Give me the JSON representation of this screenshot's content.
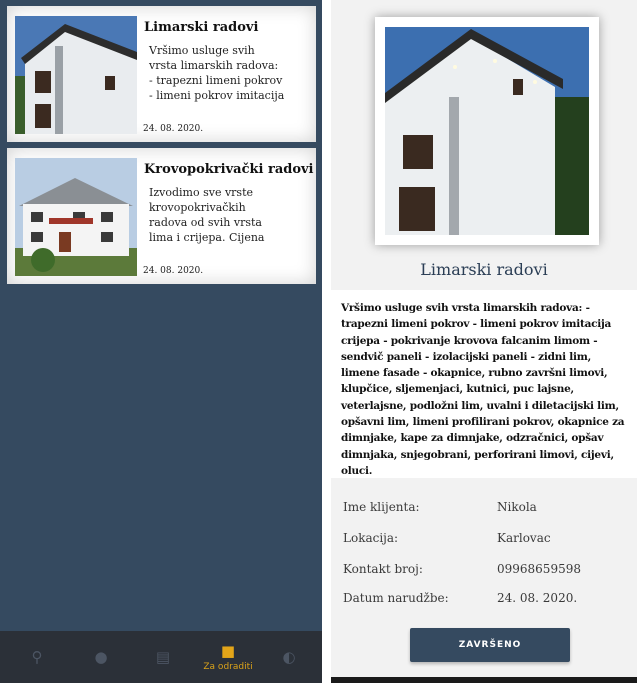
{
  "list": {
    "items": [
      {
        "title": "Limarski radovi",
        "lines": [
          "Vršimo usluge svih",
          "vrsta limarskih radova:",
          "- trapezni limeni pokrov",
          "- limeni pokrov imitacija"
        ],
        "date": "24. 08. 2020."
      },
      {
        "title": "Krovopokrivački radovi",
        "lines": [
          "Izvodimo sve vrste",
          "krovopokrivačkih",
          "radova od svih vrsta",
          "lima i crijepa.   Cijena"
        ],
        "date": "24. 08. 2020."
      }
    ]
  },
  "nav": {
    "active_label": "Za odraditi",
    "icons": [
      "search-icon",
      "person-icon",
      "list-icon",
      "briefcase-icon",
      "moon-icon"
    ],
    "accent": "#e3a519"
  },
  "detail": {
    "title": "Limarski radovi",
    "description": "Vršimo usluge svih vrsta limarskih radova: - trapezni limeni pokrov - limeni pokrov imitacija crijepa - pokrivanje krovova falcanim limom - sendvič paneli - izolacijski paneli - zidni lim, limene fasade - okapnice, rubno završni limovi, klupčice, sljemenjaci, kutnici, puc lajsne, veterlajsne, podložni lim, uvalni i diletacijski lim, opšavni lim, limeni profilirani pokrov, okapnice za dimnjake, kape za dimnjake, odzračnici, opšav dimnjaka, snjegobrani, perforirani limovi, cijevi, oluci.",
    "fields": [
      {
        "label": "Ime klijenta:",
        "value": "Nikola"
      },
      {
        "label": "Lokacija:",
        "value": "Karlovac"
      },
      {
        "label": "Kontakt broj:",
        "value": "09968659598"
      },
      {
        "label": "Datum narudžbe:",
        "value": "24. 08. 2020."
      }
    ],
    "done_label": "ZAVRŠENO"
  },
  "colors": {
    "primary": "#354a60",
    "nav_bg": "#2b3038"
  }
}
